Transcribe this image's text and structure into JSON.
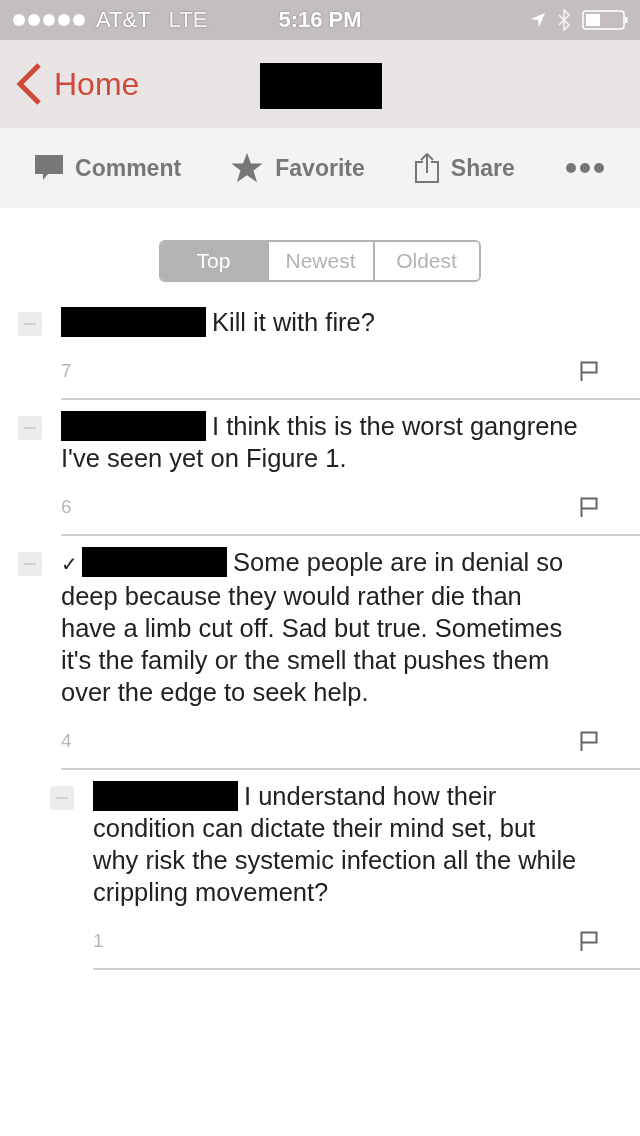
{
  "status_bar": {
    "carrier": "AT&T",
    "network": "LTE",
    "time": "5:16 PM"
  },
  "nav": {
    "back": "Home"
  },
  "toolbar": [
    {
      "kind": "comment",
      "label": "Comment"
    },
    {
      "kind": "favorite",
      "label": "Favorite"
    },
    {
      "kind": "share",
      "label": "Share"
    },
    {
      "kind": "more"
    }
  ],
  "sort_tabs": [
    {
      "label": "Top",
      "selected": true
    },
    {
      "label": "Newest",
      "selected": false
    },
    {
      "label": "Oldest",
      "selected": false
    }
  ],
  "comments": [
    {
      "text": "Kill it with fire?",
      "score": "7"
    },
    {
      "text": "I think this is the worst gangrene I've seen yet on Figure 1.",
      "score": "6"
    },
    {
      "badge": "✓",
      "text": "Some people are in denial so deep because they would rather die than have a limb cut off. Sad but true. Sometimes it's the family or the smell that pushes them over the edge to seek help.",
      "score": "4",
      "children": [
        {
          "text": "I understand how their condition can dictate their mind set, but why risk the  systemic infection all the while crippling movement?",
          "score": "1"
        }
      ]
    }
  ]
}
